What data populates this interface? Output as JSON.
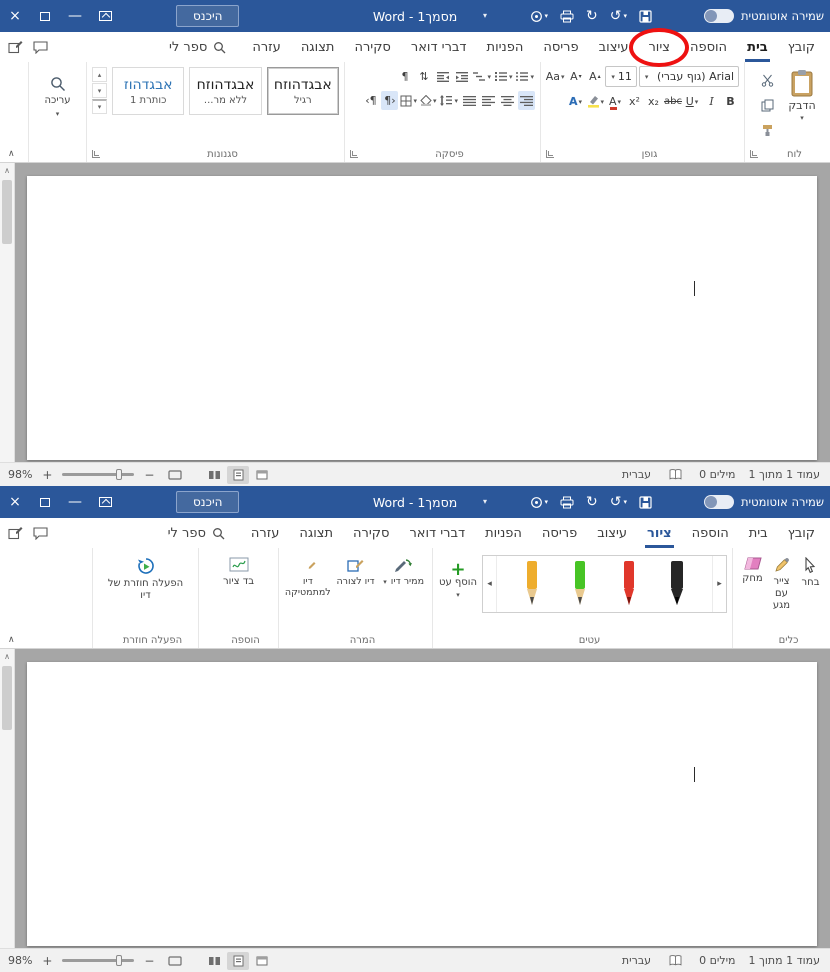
{
  "colors": {
    "titlebar_bg": "#2b579a",
    "accent": "#2b579a",
    "annotation_red": "#ee1111",
    "doc_bg": "#a6a6a6"
  },
  "titlebar": {
    "signin": "היכנס",
    "title": "מסמך1 - Word",
    "autosave": "שמירה אוטומטית"
  },
  "tabs": {
    "file": "קובץ",
    "home": "בית",
    "insert": "הוספה",
    "draw": "ציור",
    "design": "עיצוב",
    "layout": "פריסה",
    "references": "הפניות",
    "mailings": "דברי דואר",
    "review": "סקירה",
    "view": "תצוגה",
    "help": "עזרה",
    "tellme": "ספר לי"
  },
  "home": {
    "groups": {
      "clipboard": "לוח",
      "font": "גופן",
      "paragraph": "פיסקה",
      "styles": "סגנונות"
    },
    "paste": "הדבק",
    "font_name": "Arial (גוף עברי)",
    "font_size": "11",
    "bold": "B",
    "italic": "I",
    "underline": "U",
    "strike": "abc",
    "subscript": "x₂",
    "superscript": "x²",
    "grow": "A",
    "shrink": "A",
    "case": "Aa",
    "color": "A",
    "effects": "A",
    "styles": [
      {
        "preview": "אבגדהוזח",
        "name": "רגיל"
      },
      {
        "preview": "אבגדהוזח",
        "name": "ללא מר..."
      },
      {
        "preview": "אבגדהוז",
        "name": "כותרת 1"
      }
    ],
    "editing": "עריכה"
  },
  "draw": {
    "groups": {
      "tools": "כלים",
      "pens": "עטים",
      "convert": "המרה",
      "insert": "הוספה",
      "replay": "הפעלה חוזרת"
    },
    "select": "בחר",
    "touch": "צייר עם מגע",
    "eraser": "מחק",
    "add_pen": "הוסף עט",
    "pens": [
      {
        "name": "yellow-pencil",
        "body": "#eead2d",
        "tip": "#e9c98f",
        "nib": "#4a4a4a"
      },
      {
        "name": "green-pencil",
        "body": "#47c425",
        "tip": "#e9c98f",
        "nib": "#4a4a4a"
      },
      {
        "name": "red-pen",
        "body": "#e0372b",
        "tip": "#e0372b",
        "nib": "#7a150e"
      },
      {
        "name": "black-pen",
        "body": "#262626",
        "tip": "#262626",
        "nib": "#000000"
      }
    ],
    "ink_converter": "ממיר דיו",
    "ink_to_shape": "דיו לצורה",
    "ink_to_math": "דיו למתמטיקה",
    "canvas": "בד ציור",
    "replay": "הפעלה חוזרת של דיו"
  },
  "statusbar": {
    "zoom": "98%",
    "zoom_in": "+",
    "zoom_out": "−",
    "language": "עברית",
    "words": "0 מילים",
    "page": "עמוד 1 מתוך 1"
  },
  "icons": {
    "close": "×",
    "minimize": "—",
    "dropdown": "▾",
    "undo": "↺",
    "redo": "↻",
    "chevron_up": "∧",
    "scroll_left": "◂",
    "scroll_right": "▸",
    "scroll_up": "▴",
    "scroll_down": "▾",
    "pilcrow": "¶",
    "plus": "+",
    "sort": "⇅",
    "dir_ltr": "‹¶",
    "dir_rtl": "¶›"
  }
}
